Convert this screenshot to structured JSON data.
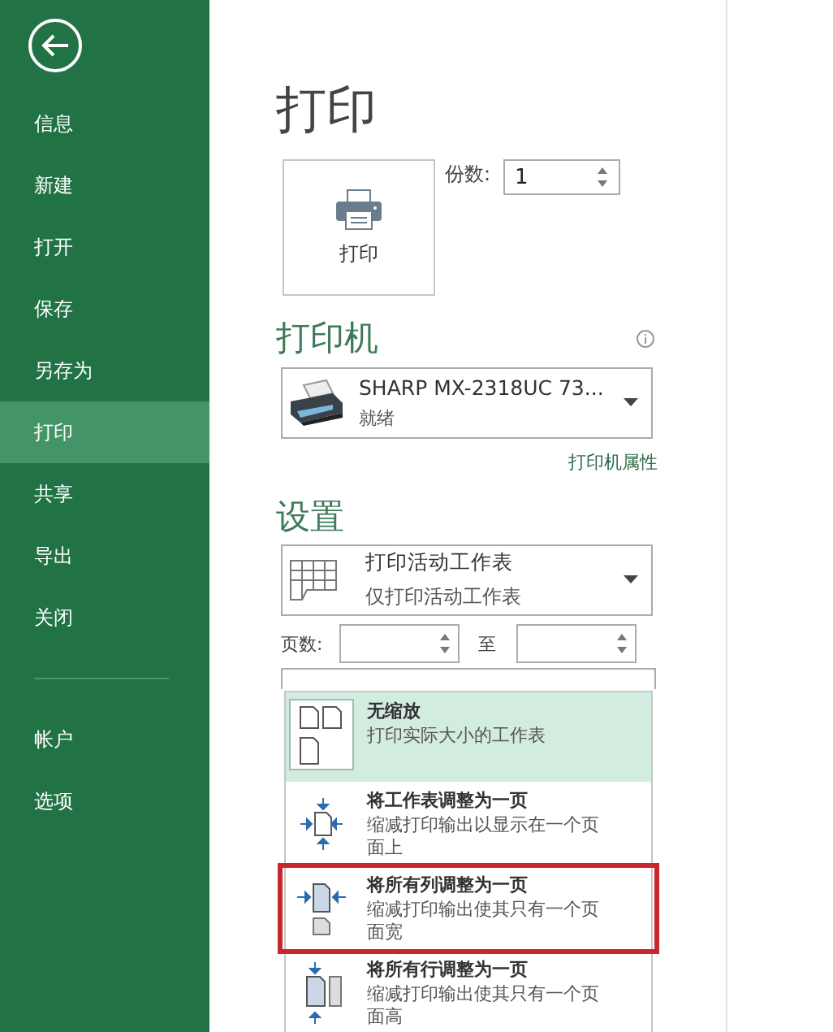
{
  "sidebar": {
    "items": [
      {
        "label": "信息",
        "selected": false
      },
      {
        "label": "新建",
        "selected": false
      },
      {
        "label": "打开",
        "selected": false
      },
      {
        "label": "保存",
        "selected": false
      },
      {
        "label": "另存为",
        "selected": false
      },
      {
        "label": "打印",
        "selected": true
      },
      {
        "label": "共享",
        "selected": false
      },
      {
        "label": "导出",
        "selected": false
      },
      {
        "label": "关闭",
        "selected": false
      }
    ],
    "footer_items": [
      {
        "label": "帐户",
        "selected": false
      },
      {
        "label": "选项",
        "selected": false
      }
    ]
  },
  "title": "打印",
  "print_button": {
    "label": "打印"
  },
  "copies": {
    "label": "份数:",
    "value": "1"
  },
  "printer": {
    "heading": "打印机",
    "name": "SHARP MX-2318UC 73...",
    "status": "就绪",
    "properties_link": "打印机属性"
  },
  "settings": {
    "heading": "设置",
    "what": {
      "title": "打印活动工作表",
      "subtitle": "仅打印活动工作表"
    },
    "pages": {
      "label": "页数:",
      "to_label": "至"
    },
    "scaling_menu": [
      {
        "kind": "none",
        "title": "无缩放",
        "description": "打印实际大小的工作表",
        "selected": true,
        "outlined": false
      },
      {
        "kind": "sheet",
        "title": "将工作表调整为一页",
        "description": "缩减打印输出以显示在一个页面上",
        "selected": false,
        "outlined": false
      },
      {
        "kind": "columns",
        "title": "将所有列调整为一页",
        "description": "缩减打印输出使其只有一个页面宽",
        "selected": false,
        "outlined": true
      },
      {
        "kind": "rows",
        "title": "将所有行调整为一页",
        "description": "缩减打印输出使其只有一个页面高",
        "selected": false,
        "outlined": false
      }
    ]
  }
}
